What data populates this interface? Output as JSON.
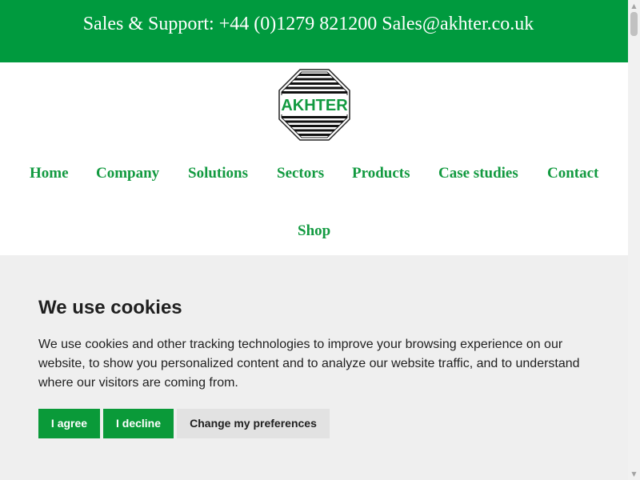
{
  "topbar": {
    "text": "Sales & Support: +44 (0)1279 821200 Sales@akhter.co.uk",
    "bg_color": "#009a3e"
  },
  "logo": {
    "text": "AKHTER",
    "accent_color": "#129a40"
  },
  "nav": {
    "items": [
      {
        "label": "Home"
      },
      {
        "label": "Company"
      },
      {
        "label": "Solutions"
      },
      {
        "label": "Sectors"
      },
      {
        "label": "Products"
      },
      {
        "label": "Case studies"
      },
      {
        "label": "Contact"
      },
      {
        "label": "Shop"
      }
    ],
    "link_color": "#129a40"
  },
  "cookie_banner": {
    "title": "We use cookies",
    "text": "We use cookies and other tracking technologies to improve your browsing experience on our website, to show you personalized content and to analyze our website traffic, and to understand where our visitors are coming from.",
    "agree_label": "I agree",
    "decline_label": "I decline",
    "preferences_label": "Change my preferences",
    "button_color": "#0a9a39",
    "background": "#efefef"
  },
  "icons": {
    "scroll_up": "chevron-up-icon",
    "scroll_down": "chevron-down-icon"
  }
}
